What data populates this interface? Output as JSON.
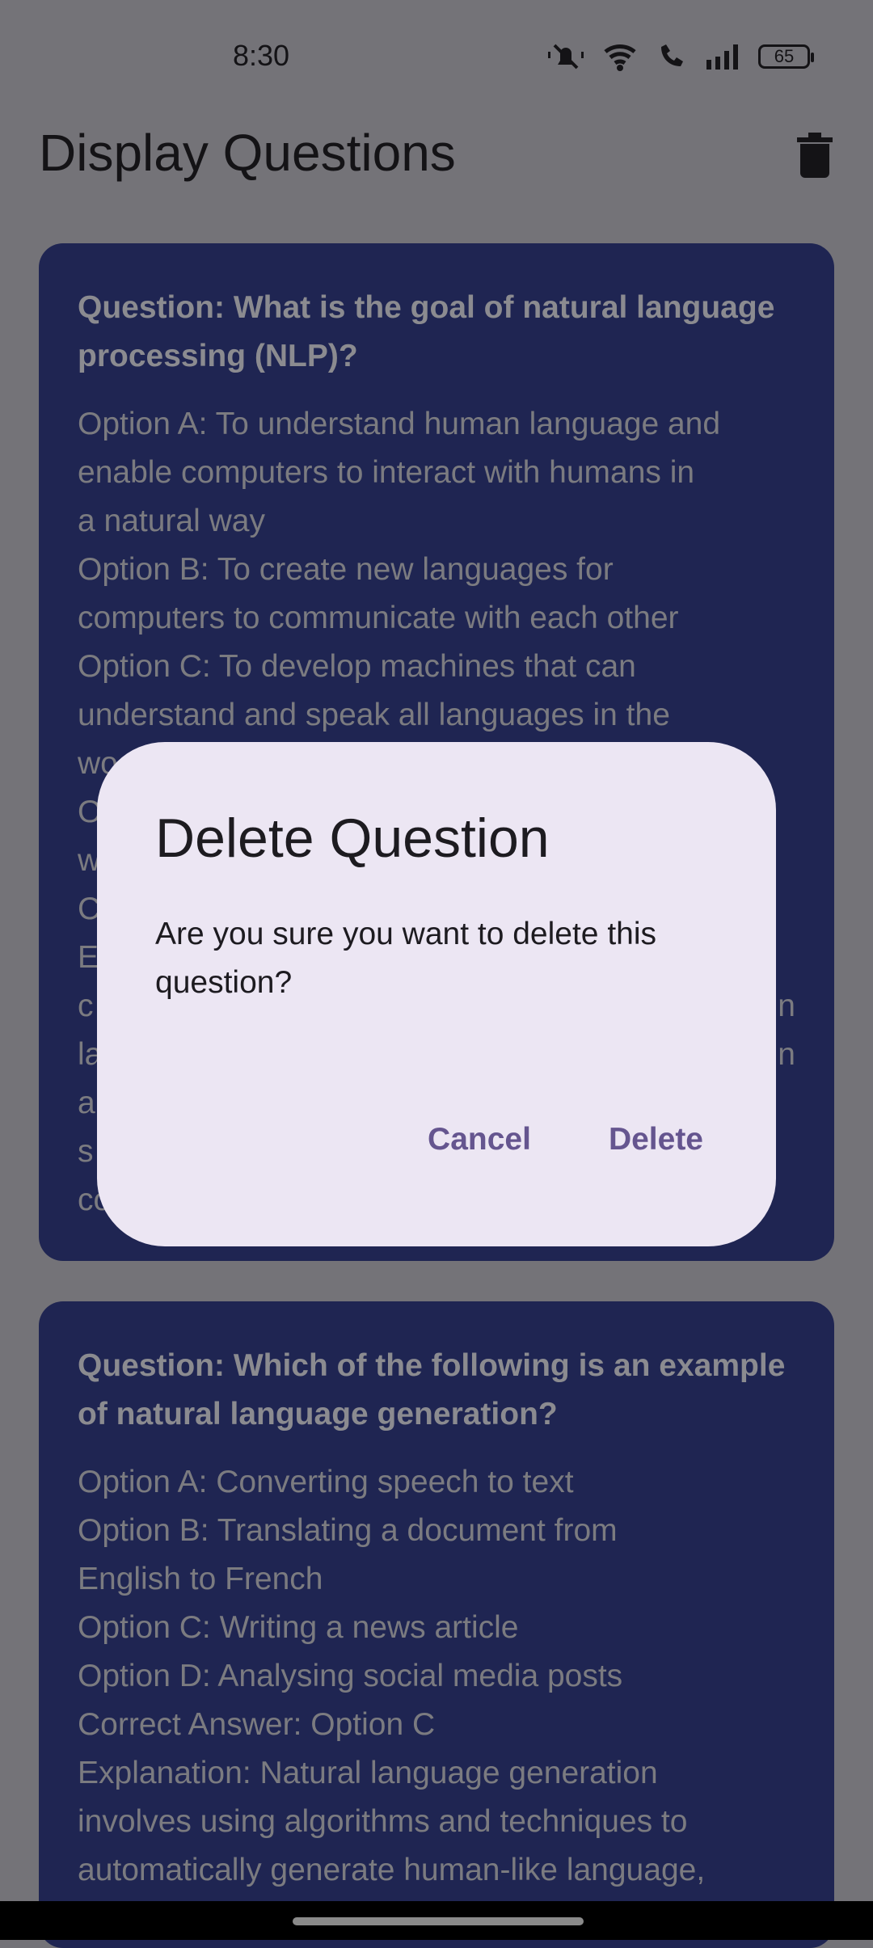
{
  "status_bar": {
    "time": "8:30",
    "battery": "65",
    "icons": [
      "mute-vibrate-icon",
      "wifi-icon",
      "wifi-calling-icon",
      "signal-icon",
      "battery-icon"
    ]
  },
  "header": {
    "title": "Display Questions",
    "action_icon": "trash-icon"
  },
  "cards": [
    {
      "question": "Question: What is the goal of natural language processing (NLP)?",
      "lines": [
        [
          "Option A: To understand human language and",
          ""
        ],
        [
          "enable computers to interact with humans in",
          ""
        ],
        [
          "a natural way",
          ""
        ],
        [
          "Option B: To create new languages for",
          ""
        ],
        [
          "computers to communicate with each other",
          ""
        ],
        [
          "Option C: To develop machines that can",
          ""
        ],
        [
          "understand and speak all languages in the",
          ""
        ],
        [
          "wo",
          ""
        ],
        [
          "O",
          ""
        ],
        [
          "w",
          ""
        ],
        [
          "C",
          ""
        ],
        [
          "E",
          ""
        ],
        [
          "c",
          "n"
        ],
        [
          "la",
          "n"
        ],
        [
          "a",
          ""
        ],
        [
          "s",
          ""
        ],
        [
          "co",
          ""
        ]
      ]
    },
    {
      "question": "Question: Which of the following is an example of natural language generation?",
      "lines": [
        "Option A: Converting speech to text",
        "Option B: Translating a document from",
        "English to French",
        "Option C: Writing a news article",
        "Option D: Analysing social media posts",
        "Correct Answer: Option C",
        "Explanation: Natural language generation",
        "involves using algorithms and techniques to",
        "automatically generate human-like language,"
      ]
    }
  ],
  "dialog": {
    "title": "Delete Question",
    "message": "Are you sure you want to delete this question?",
    "cancel": "Cancel",
    "confirm": "Delete",
    "accent": "#65558f"
  }
}
